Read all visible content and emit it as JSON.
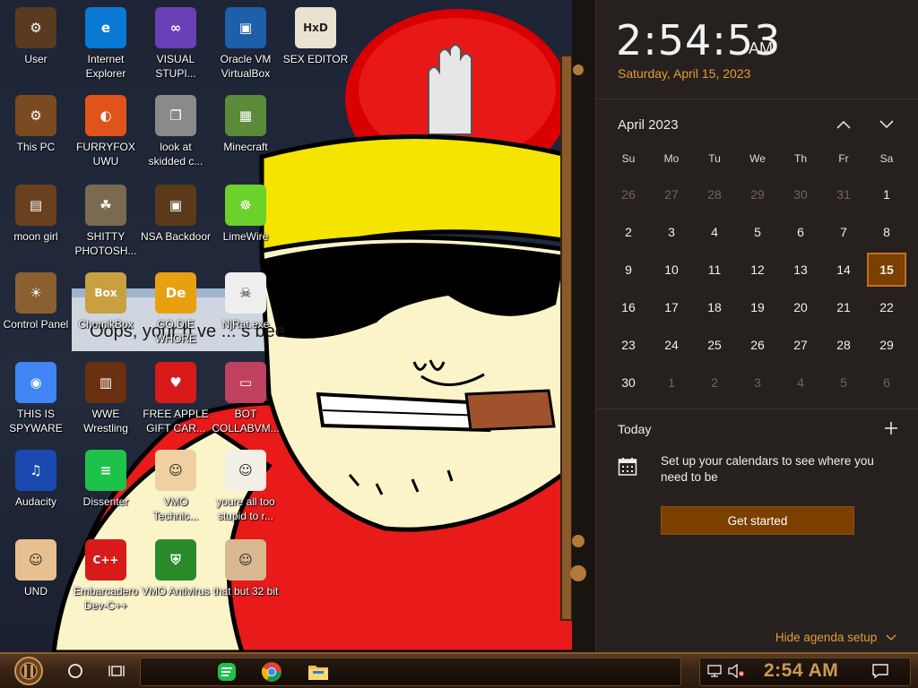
{
  "desktop": {
    "icons": [
      {
        "label": "User",
        "icon": "user-icon"
      },
      {
        "label": "Internet Explorer",
        "icon": "edge-icon"
      },
      {
        "label": "VISUAL STUPI...",
        "icon": "visual-studio-icon"
      },
      {
        "label": "Oracle VM VirtualBox",
        "icon": "virtualbox-icon"
      },
      {
        "label": "SEX EDITOR",
        "icon": "hex-editor-icon"
      },
      {
        "label": "This PC",
        "icon": "this-pc-icon"
      },
      {
        "label": "FURRYFOX UWU",
        "icon": "firefox-icon"
      },
      {
        "label": "look at skidded c...",
        "icon": "stacked-windows-icon"
      },
      {
        "label": "Minecraft",
        "icon": "minecraft-icon"
      },
      {
        "label": "moon girl",
        "icon": "steampunk-box-icon"
      },
      {
        "label": "SHITTY PHOTOSH...",
        "icon": "gimp-icon"
      },
      {
        "label": "NSA Backdoor",
        "icon": "steampunk-monitor-icon"
      },
      {
        "label": "LimeWire",
        "icon": "limewire-icon"
      },
      {
        "label": "Control Panel",
        "icon": "lightbulb-icon"
      },
      {
        "label": "ChomikBox",
        "icon": "chomikbox-icon"
      },
      {
        "label": "GO DIE WHORE",
        "icon": "de-icon"
      },
      {
        "label": "NjRat.exe",
        "icon": "skull-icon"
      },
      {
        "label": "THIS IS SPYWARE",
        "icon": "chrome-icon"
      },
      {
        "label": "WWE Wrestling",
        "icon": "steampunk-tv-icon"
      },
      {
        "label": "FREE APPLE GIFT CAR...",
        "icon": "apple-icon"
      },
      {
        "label": "BOT COLLABVM...",
        "icon": "glass-monitor-icon"
      },
      {
        "label": "Audacity",
        "icon": "audacity-icon"
      },
      {
        "label": "Dissenter",
        "icon": "dissenter-icon"
      },
      {
        "label": "VMO Technic...",
        "icon": "technician-icon"
      },
      {
        "label": "youre all too stupid to r...",
        "icon": "portrait-icon"
      },
      {
        "label": "UND",
        "icon": "hank-icon"
      },
      {
        "label": "Embarcadero Dev-C++",
        "icon": "devcpp-icon"
      },
      {
        "label": "VMO Antivirus",
        "icon": "shield-icon"
      },
      {
        "label": "that but 32 bit",
        "icon": "portrait-woman-icon"
      }
    ],
    "wallpaper_caption": "Oops, your h ve ... s bee"
  },
  "clock_pane": {
    "time": "2:54:53",
    "ampm": "AM",
    "date": "Saturday, April 15, 2023",
    "calendar": {
      "month_label": "April 2023",
      "weekdays": [
        "Su",
        "Mo",
        "Tu",
        "We",
        "Th",
        "Fr",
        "Sa"
      ],
      "days": [
        {
          "n": "26",
          "cur": false
        },
        {
          "n": "27",
          "cur": false
        },
        {
          "n": "28",
          "cur": false
        },
        {
          "n": "29",
          "cur": false
        },
        {
          "n": "30",
          "cur": false
        },
        {
          "n": "31",
          "cur": false
        },
        {
          "n": "1",
          "cur": true
        },
        {
          "n": "2",
          "cur": true
        },
        {
          "n": "3",
          "cur": true
        },
        {
          "n": "4",
          "cur": true
        },
        {
          "n": "5",
          "cur": true
        },
        {
          "n": "6",
          "cur": true
        },
        {
          "n": "7",
          "cur": true
        },
        {
          "n": "8",
          "cur": true
        },
        {
          "n": "9",
          "cur": true
        },
        {
          "n": "10",
          "cur": true
        },
        {
          "n": "11",
          "cur": true
        },
        {
          "n": "12",
          "cur": true
        },
        {
          "n": "13",
          "cur": true
        },
        {
          "n": "14",
          "cur": true
        },
        {
          "n": "15",
          "cur": true,
          "today": true
        },
        {
          "n": "16",
          "cur": true
        },
        {
          "n": "17",
          "cur": true
        },
        {
          "n": "18",
          "cur": true
        },
        {
          "n": "19",
          "cur": true
        },
        {
          "n": "20",
          "cur": true
        },
        {
          "n": "21",
          "cur": true
        },
        {
          "n": "22",
          "cur": true
        },
        {
          "n": "23",
          "cur": true
        },
        {
          "n": "24",
          "cur": true
        },
        {
          "n": "25",
          "cur": true
        },
        {
          "n": "26",
          "cur": true
        },
        {
          "n": "27",
          "cur": true
        },
        {
          "n": "28",
          "cur": true
        },
        {
          "n": "29",
          "cur": true
        },
        {
          "n": "30",
          "cur": true
        },
        {
          "n": "1",
          "cur": false
        },
        {
          "n": "2",
          "cur": false
        },
        {
          "n": "3",
          "cur": false
        },
        {
          "n": "4",
          "cur": false
        },
        {
          "n": "5",
          "cur": false
        },
        {
          "n": "6",
          "cur": false
        }
      ]
    },
    "agenda": {
      "title": "Today",
      "setup_text": "Set up your calendars to see where you need to be",
      "button_label": "Get started",
      "hide_label": "Hide agenda setup"
    }
  },
  "taskbar": {
    "clock": "2:54 AM",
    "pinned": [
      "dissenter-icon",
      "chrome-icon",
      "file-explorer-icon"
    ],
    "colors": {
      "accent": "#7b3f00",
      "accent_text": "#e39a3a",
      "brass": "#c89a55"
    }
  }
}
